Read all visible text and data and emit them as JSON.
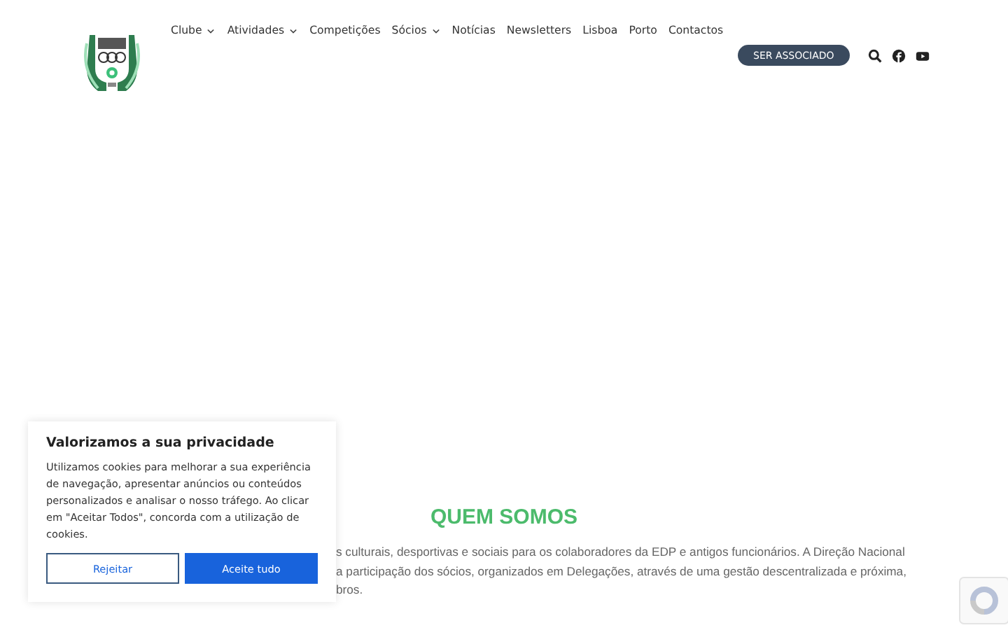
{
  "nav": {
    "items": [
      {
        "label": "Clube",
        "has_dropdown": true
      },
      {
        "label": "Atividades",
        "has_dropdown": true
      },
      {
        "label": "Competições",
        "has_dropdown": false
      },
      {
        "label": "Sócios",
        "has_dropdown": true
      },
      {
        "label": "Notícias",
        "has_dropdown": false
      },
      {
        "label": "Newsletters",
        "has_dropdown": false
      },
      {
        "label": "Lisboa",
        "has_dropdown": false
      },
      {
        "label": "Porto",
        "has_dropdown": false
      },
      {
        "label": "Contactos",
        "has_dropdown": false
      }
    ],
    "cta": "SER ASSOCIADO"
  },
  "about": {
    "heading": "QUEM SOMOS",
    "lines": [
      "s culturais, desportivas e sociais para os colaboradores da EDP e antigos funcionários. A Direção Nacional",
      "a participação dos sócios, organizados em Delegações, através de uma gestão descentralizada e próxima,",
      "bros."
    ]
  },
  "cookie_banner": {
    "title": "Valorizamos a sua privacidade",
    "text": "Utilizamos cookies para melhorar a sua experiência de navegação, apresentar anúncios ou conteúdos personalizados e analisar o nosso tráfego. Ao clicar em \"Aceitar Todos\", concorda com a utilização de cookies.",
    "reject": "Rejeitar",
    "accept": "Aceite tudo"
  }
}
